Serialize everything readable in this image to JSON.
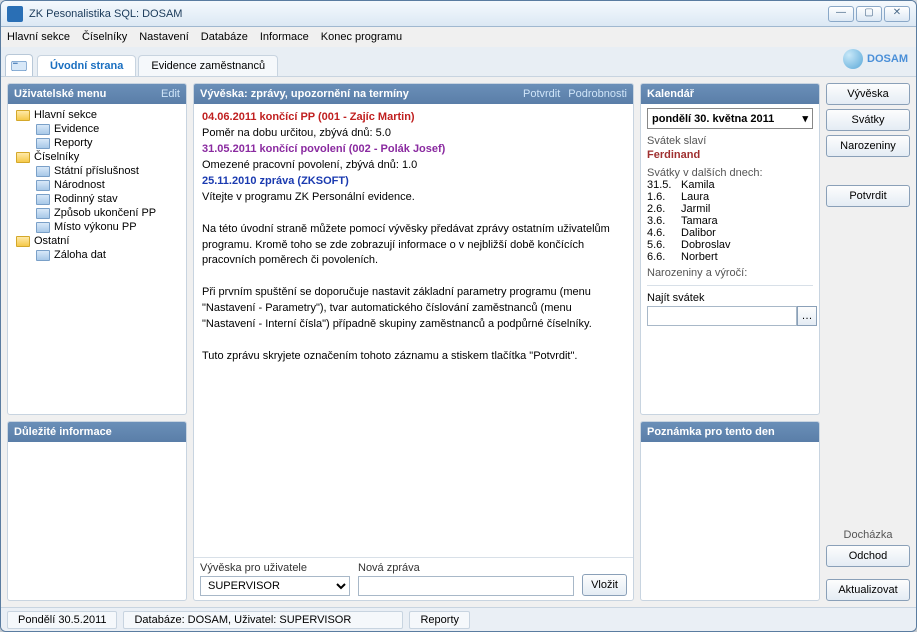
{
  "window": {
    "title": "ZK Pesonalistika SQL: DOSAM"
  },
  "menu": {
    "items": [
      "Hlavní sekce",
      "Číselníky",
      "Nastavení",
      "Databáze",
      "Informace",
      "Konec programu"
    ]
  },
  "tabs": {
    "home": "Úvodní strana",
    "employees": "Evidence zaměstnanců",
    "logo": "DOSAM"
  },
  "left": {
    "menu_title": "Uživatelské menu",
    "edit": "Edit",
    "tree": {
      "g1": "Hlavní sekce",
      "g1_items": [
        "Evidence",
        "Reporty"
      ],
      "g2": "Číselníky",
      "g2_items": [
        "Státní příslušnost",
        "Národnost",
        "Rodinný stav",
        "Způsob ukončení PP",
        "Místo výkonu PP"
      ],
      "g3": "Ostatní",
      "g3_items": [
        "Záloha dat"
      ]
    },
    "info_title": "Důležité informace"
  },
  "center": {
    "title": "Vývěska: zprávy, upozornění na termíny",
    "confirm": "Potvrdit",
    "details": "Podrobnosti",
    "l1": "04.06.2011 končící PP (001 - Zajíc Martin)",
    "l2": "Poměr na dobu určitou, zbývá dnů: 5.0",
    "l3": "31.05.2011 končící povolení (002 - Polák Josef)",
    "l4": "Omezené pracovní povolení, zbývá dnů: 1.0",
    "l5": "25.11.2010 zpráva (ZKSOFT)",
    "l6": "Vítejte v programu ZK Personální evidence.",
    "l7": "Na této úvodní straně můžete pomocí vývěsky předávat zprávy ostatním uživatelům programu. Kromě toho se zde zobrazují informace o v nejbližší době končících pracovních poměrech či povoleních.",
    "l8": "Při prvním spuštění se doporučuje nastavit základní parametry programu (menu \"Nastavení - Parametry\"), tvar automatického číslování zaměstnanců (menu \"Nastavení - Interní čísla\") případně skupiny zaměstnanců a podpůrné číselníky.",
    "l9": "Tuto zprávu skryjete označením tohoto záznamu a stiskem tlačítka \"Potvrdit\".",
    "user_label": "Vývěska pro uživatele",
    "user_value": "SUPERVISOR",
    "new_label": "Nová zpráva",
    "insert": "Vložit"
  },
  "cal": {
    "title": "Kalendář",
    "date": "pondělí 30.  května  2011",
    "svatek_label": "Svátek slaví",
    "svatek_name": "Ferdinand",
    "next_label": "Svátky v dalších dnech:",
    "days": [
      {
        "d": "31.5.",
        "n": "Kamila"
      },
      {
        "d": "1.6.",
        "n": "Laura"
      },
      {
        "d": "2.6.",
        "n": "Jarmil"
      },
      {
        "d": "3.6.",
        "n": "Tamara"
      },
      {
        "d": "4.6.",
        "n": "Dalibor"
      },
      {
        "d": "5.6.",
        "n": "Dobroslav"
      },
      {
        "d": "6.6.",
        "n": "Norbert"
      }
    ],
    "birth_label": "Narozeniny a výročí:",
    "search_svatek": "Najít svátek",
    "search_nar": "narozeniny",
    "note_title": "Poznámka pro tento den"
  },
  "right": {
    "vyveska": "Vývěska",
    "svatky": "Svátky",
    "narozeniny": "Narozeniny",
    "potvrdit": "Potvrdit",
    "dochazka": "Docházka",
    "odchod": "Odchod",
    "aktualizovat": "Aktualizovat"
  },
  "status": {
    "date": "Pondělí 30.5.2011",
    "db": "Databáze: DOSAM, Uživatel: SUPERVISOR",
    "reporty": "Reporty"
  }
}
